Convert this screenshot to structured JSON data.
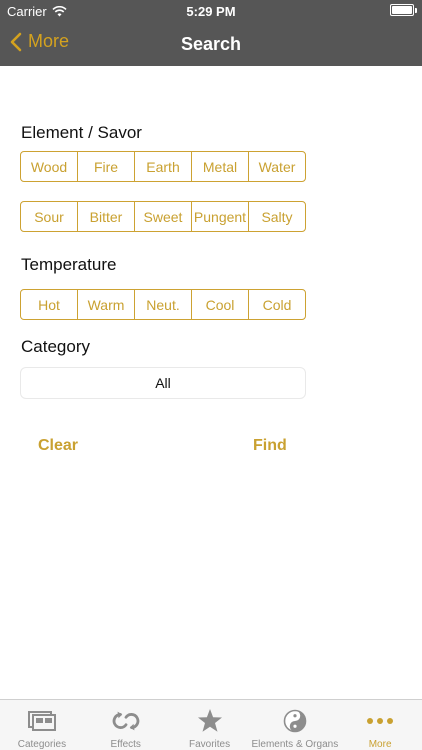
{
  "status_bar": {
    "carrier": "Carrier",
    "time": "5:29 PM"
  },
  "nav": {
    "back_label": "More",
    "title": "Search"
  },
  "element_section": {
    "title": "Element / Savor",
    "elements": [
      "Wood",
      "Fire",
      "Earth",
      "Metal",
      "Water"
    ],
    "savors": [
      "Sour",
      "Bitter",
      "Sweet",
      "Pungent",
      "Salty"
    ]
  },
  "temperature_section": {
    "title": "Temperature",
    "options": [
      "Hot",
      "Warm",
      "Neut.",
      "Cool",
      "Cold"
    ]
  },
  "category_section": {
    "title": "Category",
    "value": "All"
  },
  "actions": {
    "clear_label": "Clear",
    "find_label": "Find"
  },
  "tabs": [
    {
      "label": "Categories",
      "icon": "categories-icon"
    },
    {
      "label": "Effects",
      "icon": "effects-icon"
    },
    {
      "label": "Favorites",
      "icon": "star-icon"
    },
    {
      "label": "Elements & Organs",
      "icon": "yin-yang-icon"
    },
    {
      "label": "More",
      "icon": "more-icon",
      "active": true
    }
  ],
  "colors": {
    "accent": "#c9a131",
    "nav_background": "#565656",
    "tab_inactive": "#8d8d8d"
  }
}
